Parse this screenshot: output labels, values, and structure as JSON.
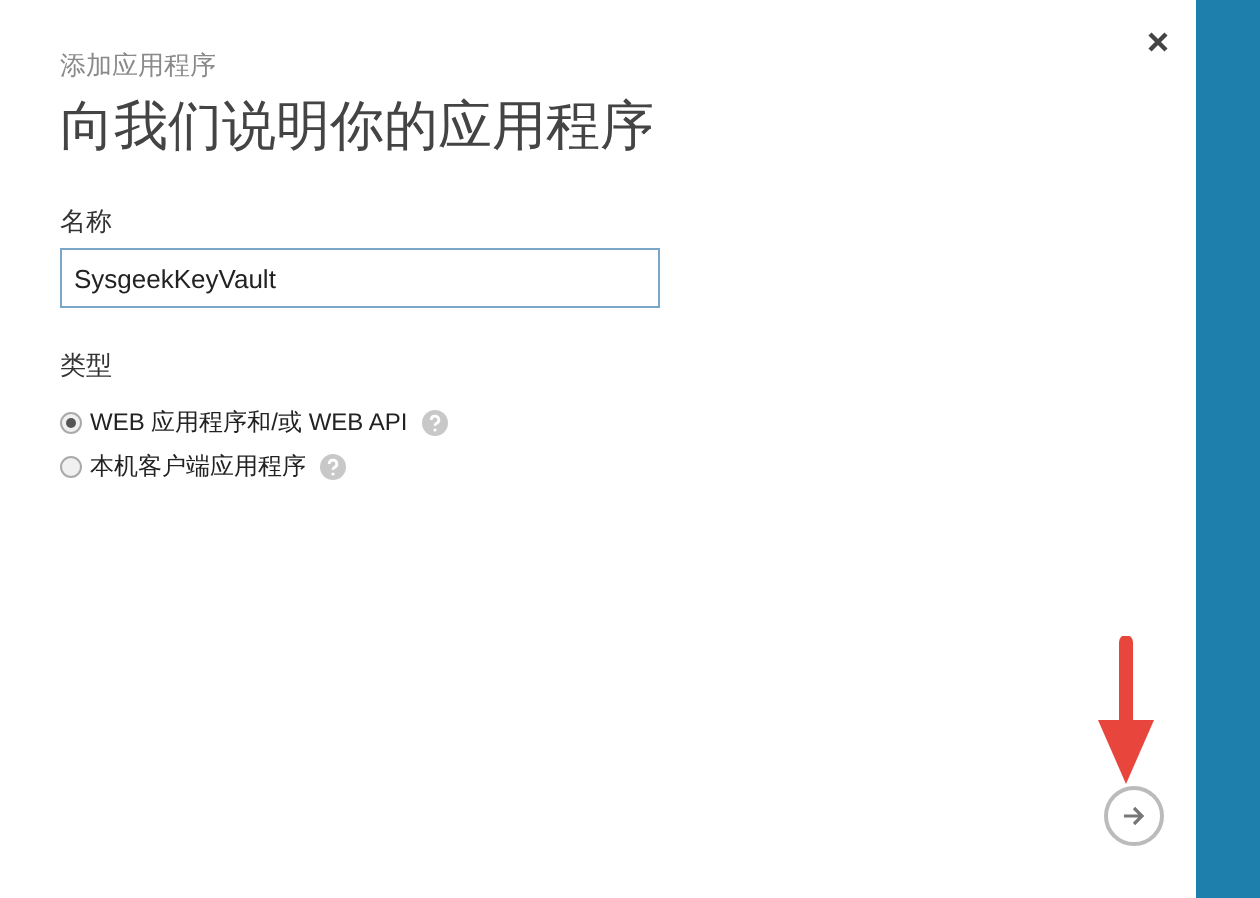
{
  "dialog": {
    "subtitle": "添加应用程序",
    "title": "向我们说明你的应用程序",
    "name_field": {
      "label": "名称",
      "value": "SysgeekKeyVault"
    },
    "type_group": {
      "label": "类型",
      "options": [
        {
          "label": "WEB 应用程序和/或 WEB API",
          "selected": true
        },
        {
          "label": "本机客户端应用程序",
          "selected": false
        }
      ]
    }
  }
}
